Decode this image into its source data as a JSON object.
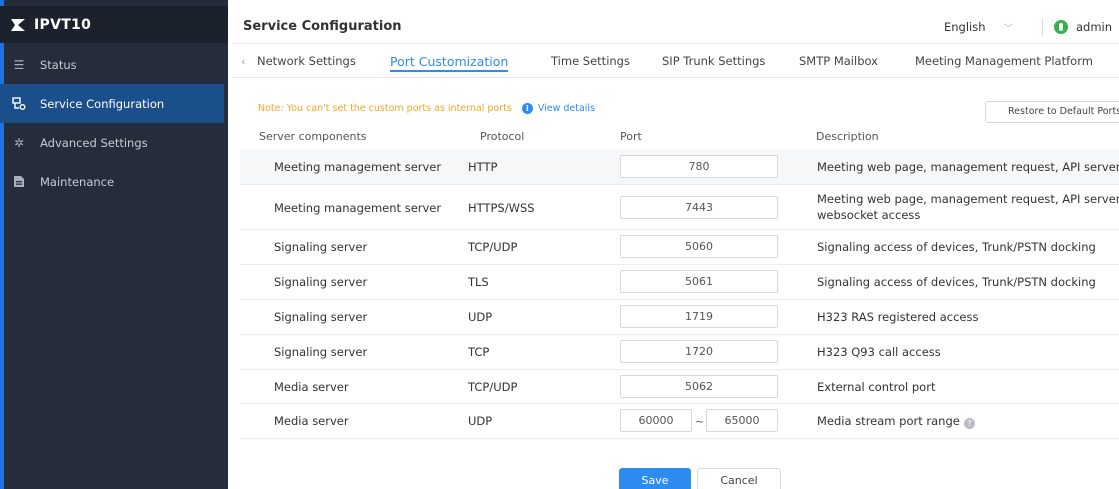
{
  "app": {
    "name": "IPVT10"
  },
  "sidebar": {
    "items": [
      {
        "label": "Status",
        "icon": "list-icon"
      },
      {
        "label": "Service Configuration",
        "icon": "service-config-icon",
        "active": true
      },
      {
        "label": "Advanced Settings",
        "icon": "gear-icon"
      },
      {
        "label": "Maintenance",
        "icon": "maintenance-icon"
      }
    ]
  },
  "header": {
    "title": "Service Configuration",
    "language": "English",
    "user": "admin"
  },
  "tabs": [
    {
      "label": "Network Settings"
    },
    {
      "label": "Port Customization",
      "active": true
    },
    {
      "label": "Time Settings"
    },
    {
      "label": "SIP Trunk Settings"
    },
    {
      "label": "SMTP Mailbox"
    },
    {
      "label": "Meeting Management Platform"
    }
  ],
  "note": {
    "text": "Note: You can't set the custom ports as internal ports",
    "link": "View details"
  },
  "restore_button": "Restore to Default Ports",
  "table": {
    "headers": [
      "Server components",
      "Protocol",
      "Port",
      "Description"
    ],
    "rows": [
      {
        "component": "Meeting management server",
        "protocol": "HTTP",
        "port": "780",
        "description": "Meeting web page, management request, API server"
      },
      {
        "component": "Meeting management server",
        "protocol": "HTTPS/WSS",
        "port": "7443",
        "description": "Meeting web page, management request, API server, websocket access"
      },
      {
        "component": "Signaling server",
        "protocol": "TCP/UDP",
        "port": "5060",
        "description": "Signaling access of devices, Trunk/PSTN docking"
      },
      {
        "component": "Signaling server",
        "protocol": "TLS",
        "port": "5061",
        "description": "Signaling access of devices, Trunk/PSTN docking"
      },
      {
        "component": "Signaling server",
        "protocol": "UDP",
        "port": "1719",
        "description": "H323 RAS registered access"
      },
      {
        "component": "Signaling server",
        "protocol": "TCP",
        "port": "1720",
        "description": "H323 Q93 call access"
      },
      {
        "component": "Media server",
        "protocol": "TCP/UDP",
        "port": "5062",
        "description": "External control port"
      },
      {
        "component": "Media server",
        "protocol": "UDP",
        "port_start": "60000",
        "range_sep": "~",
        "port_end": "65000",
        "description": "Media stream port range"
      }
    ]
  },
  "footer": {
    "save": "Save",
    "cancel": "Cancel"
  },
  "colors": {
    "accent": "#2d8cf0",
    "sidebar_bg": "#252c3a",
    "active_nav": "#1b4f8c",
    "note": "#f5a623"
  }
}
